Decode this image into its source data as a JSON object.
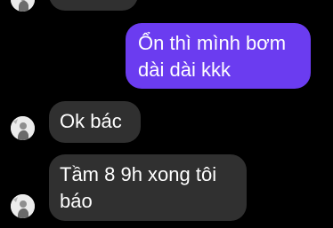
{
  "conversation": {
    "messages": [
      {
        "direction": "incoming",
        "text": ""
      },
      {
        "direction": "outgoing",
        "text": "Ổn thì mình bơm dài dài kkk"
      },
      {
        "direction": "incoming",
        "text": "Ok bác"
      },
      {
        "direction": "incoming",
        "text": "Tầm 8 9h xong tôi báo"
      }
    ]
  },
  "colors": {
    "background": "#000000",
    "incoming_bubble": "#303030",
    "outgoing_bubble": "#6b3cf0",
    "text": "#ffffff"
  },
  "icons": {
    "avatar": "contact-avatar-icon"
  }
}
